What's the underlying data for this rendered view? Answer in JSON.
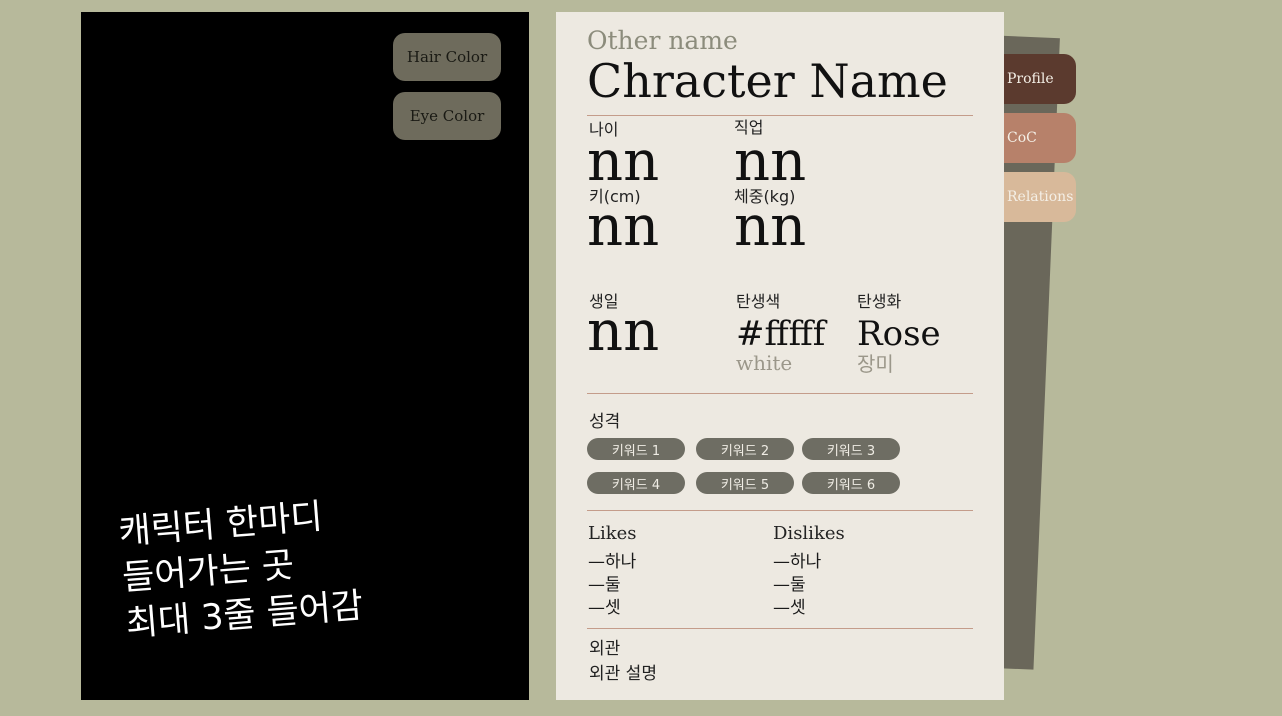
{
  "portrait": {
    "hair_color_label": "Hair Color",
    "eye_color_label": "Eye Color",
    "quote_lines": [
      "캐릭터 한마디",
      "들어가는 곳",
      "최대 3줄 들어감"
    ]
  },
  "tabs": {
    "profile": "Profile",
    "coc": "CoC",
    "relations": "Relations"
  },
  "profile": {
    "other_name": "Other name",
    "character_name": "Chracter Name",
    "age": {
      "label": "나이",
      "value": "nn"
    },
    "job": {
      "label": "직업",
      "value": "nn"
    },
    "height": {
      "label": "키(cm)",
      "value": "nn"
    },
    "weight": {
      "label": "체중(kg)",
      "value": "nn"
    },
    "birthday": {
      "label": "생일",
      "value": "nn"
    },
    "birth_color": {
      "label": "탄생색",
      "value": "#fffff",
      "name": "white"
    },
    "birth_flower": {
      "label": "탄생화",
      "value": "Rose",
      "name": "장미"
    },
    "personality": {
      "label": "성격",
      "keywords": [
        "키워드 1",
        "키워드 2",
        "키워드 3",
        "키워드 4",
        "키워드 5",
        "키워드 6"
      ]
    },
    "likes": {
      "label": "Likes",
      "items": [
        "—하나",
        "—둘",
        "—셋"
      ]
    },
    "dislikes": {
      "label": "Dislikes",
      "items": [
        "—하나",
        "—둘",
        "—셋"
      ]
    },
    "appearance": {
      "label": "외관",
      "description": "외관 설명"
    }
  },
  "colors": {
    "background": "#b7b99b",
    "sheet": "#ede9e1",
    "tab_profile": "#5b3a2e",
    "tab_coc": "#b7816a",
    "tab_relations": "#d8b99a",
    "divider": "#c49c8a",
    "keyword_pill": "#6e6d63"
  }
}
